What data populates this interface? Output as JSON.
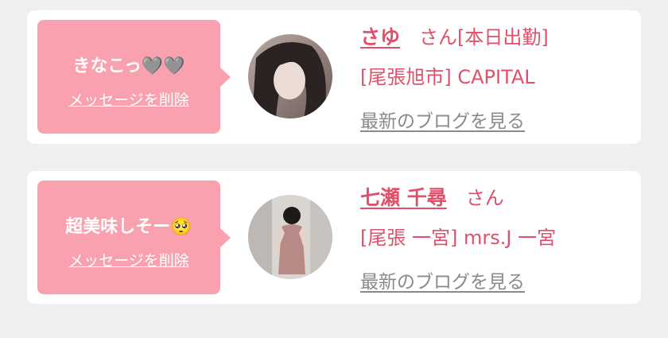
{
  "messages": [
    {
      "text": "きなこっ🩶🩶",
      "delete_label": "メッセージを削除",
      "name": "さゆ",
      "honorific": "さん",
      "status_tag": "[本日出勤]",
      "shop": "[尾張旭市] CAPITAL",
      "blog_link": "最新のブログを見る"
    },
    {
      "text": "超美味しそー🥺",
      "delete_label": "メッセージを削除",
      "name": "七瀬 千尋",
      "honorific": "さん",
      "status_tag": "",
      "shop": "[尾張 一宮] mrs.J 一宮",
      "blog_link": "最新のブログを見る"
    }
  ],
  "colors": {
    "accent": "#e0506a",
    "bubble": "#f9a1ae",
    "link_gray": "#8a8a8a",
    "background": "#efefef"
  }
}
